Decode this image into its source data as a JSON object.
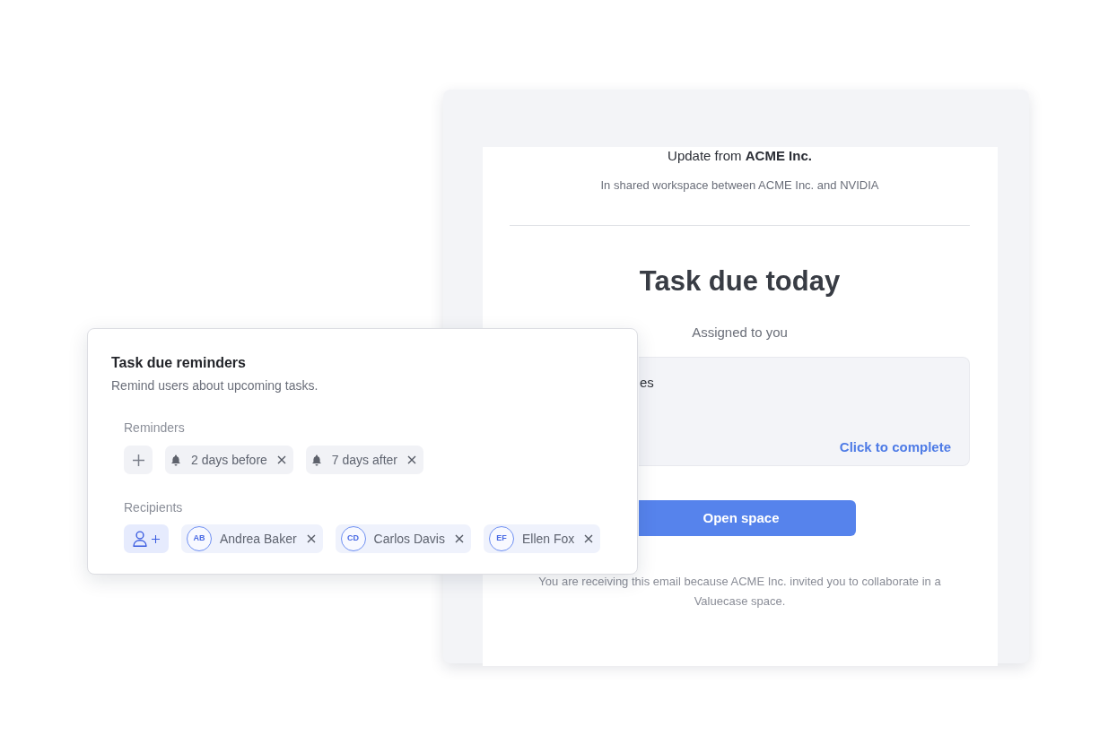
{
  "email": {
    "header": "Update from **ACME Inc.**",
    "subtitle": "In shared workspace between ACME Inc. and NVIDIA",
    "title": "Task due today",
    "assignment": "Assigned to you",
    "task": {
      "name": "es",
      "action": "Click to complete"
    },
    "button": "Open space",
    "footer": "You are receiving this email because ACME Inc. invited you to collaborate in a Valuecase space."
  },
  "reminders_card": {
    "title": "Task due reminders",
    "description": "Remind users about upcoming tasks.",
    "reminders": {
      "label": "Reminders",
      "items": [
        {
          "label": "2 days before"
        },
        {
          "label": "7 days after"
        }
      ]
    },
    "recipients": {
      "label": "Recipients",
      "items": [
        {
          "initials": "AB",
          "name": "Andrea Baker"
        },
        {
          "initials": "CD",
          "name": "Carlos Davis"
        },
        {
          "initials": "EF",
          "name": "Ellen Fox"
        }
      ]
    }
  }
}
